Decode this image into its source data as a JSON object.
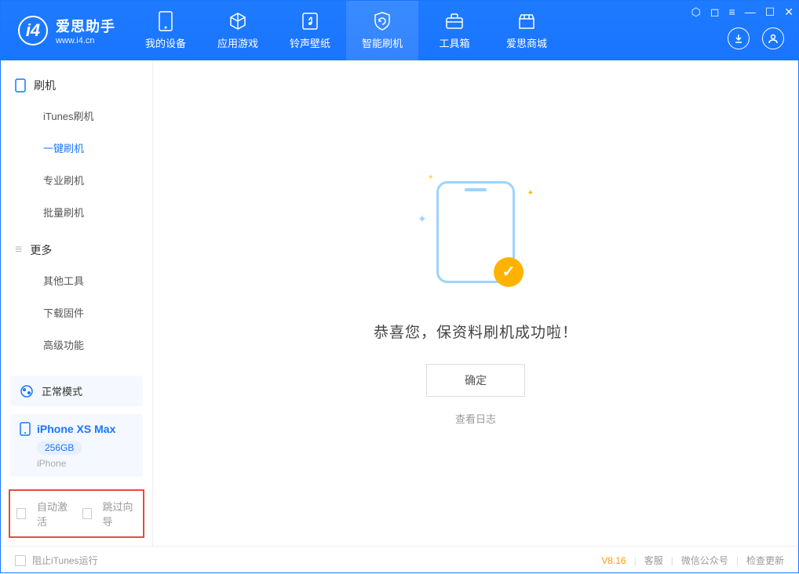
{
  "header": {
    "app_name": "爱思助手",
    "app_url": "www.i4.cn",
    "tabs": [
      {
        "label": "我的设备"
      },
      {
        "label": "应用游戏"
      },
      {
        "label": "铃声壁纸"
      },
      {
        "label": "智能刷机"
      },
      {
        "label": "工具箱"
      },
      {
        "label": "爱思商城"
      }
    ]
  },
  "sidebar": {
    "group1_title": "刷机",
    "group1_items": [
      {
        "label": "iTunes刷机"
      },
      {
        "label": "一键刷机"
      },
      {
        "label": "专业刷机"
      },
      {
        "label": "批量刷机"
      }
    ],
    "group2_title": "更多",
    "group2_items": [
      {
        "label": "其他工具"
      },
      {
        "label": "下载固件"
      },
      {
        "label": "高级功能"
      }
    ],
    "mode_label": "正常模式",
    "device_name": "iPhone XS Max",
    "device_capacity": "256GB",
    "device_type": "iPhone",
    "auto_activate_label": "自动激活",
    "skip_wizard_label": "跳过向导"
  },
  "main": {
    "success_text": "恭喜您，保资料刷机成功啦！",
    "ok_button": "确定",
    "view_log": "查看日志"
  },
  "footer": {
    "block_itunes": "阻止iTunes运行",
    "version": "V8.16",
    "support": "客服",
    "wechat": "微信公众号",
    "check_update": "检查更新"
  }
}
